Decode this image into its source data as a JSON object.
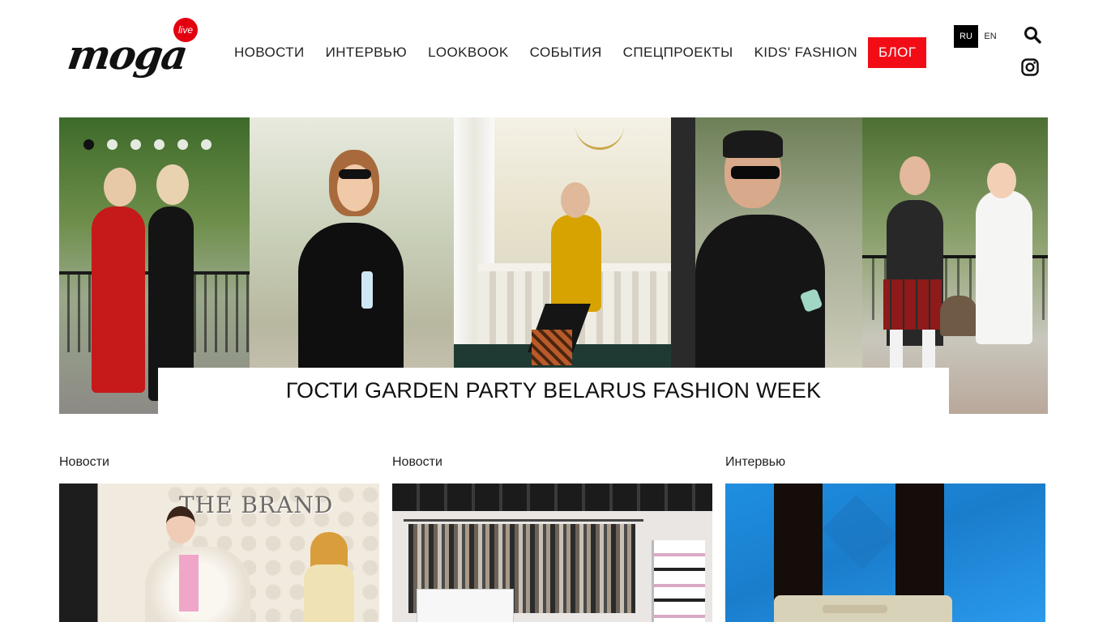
{
  "header": {
    "logo_text": "moga",
    "logo_badge": "live",
    "nav": [
      {
        "label": "НОВОСТИ"
      },
      {
        "label": "ИНТЕРВЬЮ"
      },
      {
        "label": "LOOKBOOK"
      },
      {
        "label": "СОБЫТИЯ"
      },
      {
        "label": "СПЕЦПРОЕКТЫ"
      },
      {
        "label": "KIDS' FASHION"
      },
      {
        "label": "БЛОГ"
      }
    ],
    "lang": {
      "ru": "RU",
      "en": "EN",
      "active": "RU"
    },
    "icons": {
      "search": "search-icon",
      "instagram": "instagram-icon"
    }
  },
  "slider": {
    "caption": "ГОСТИ GARDEN PARTY BELARUS FASHION WEEK",
    "dots_count": 6,
    "active_dot": 1
  },
  "cards": [
    {
      "category": "Новости",
      "image_text": "THE BRAND"
    },
    {
      "category": "Новости"
    },
    {
      "category": "Интервью"
    }
  ],
  "colors": {
    "accent": "#f20d16",
    "lang_active_bg": "#000000",
    "text": "#111111"
  }
}
